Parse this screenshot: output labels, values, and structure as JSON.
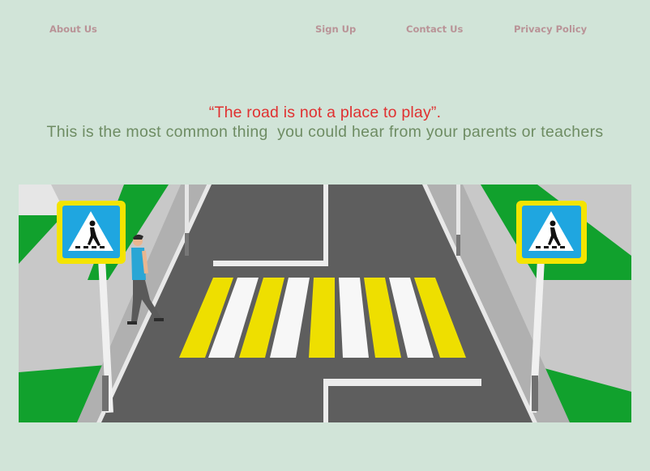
{
  "nav": {
    "about": "About Us",
    "signup": "Sign Up",
    "contact": "Contact Us",
    "privacy": "Privacy Policy"
  },
  "hero": {
    "quote": "“The road is not a place to play”.",
    "subline": "This is the most common thing  you could hear from your parents or teachers"
  },
  "illustration": {
    "subject": "pedestrian crossing with road signs",
    "left_sign_icon": "pedestrian-crossing-icon",
    "right_sign_icon": "pedestrian-crossing-icon"
  },
  "colors": {
    "background": "#d1e4d8",
    "nav_text": "#b99397",
    "quote_text": "#e03030",
    "subline_text": "#6e8c63",
    "road": "#5e5e5e",
    "stripe_yellow": "#eedf00",
    "grass": "#11a12d",
    "sign_blue": "#1fa6e0",
    "sign_frame": "#f4e400"
  }
}
